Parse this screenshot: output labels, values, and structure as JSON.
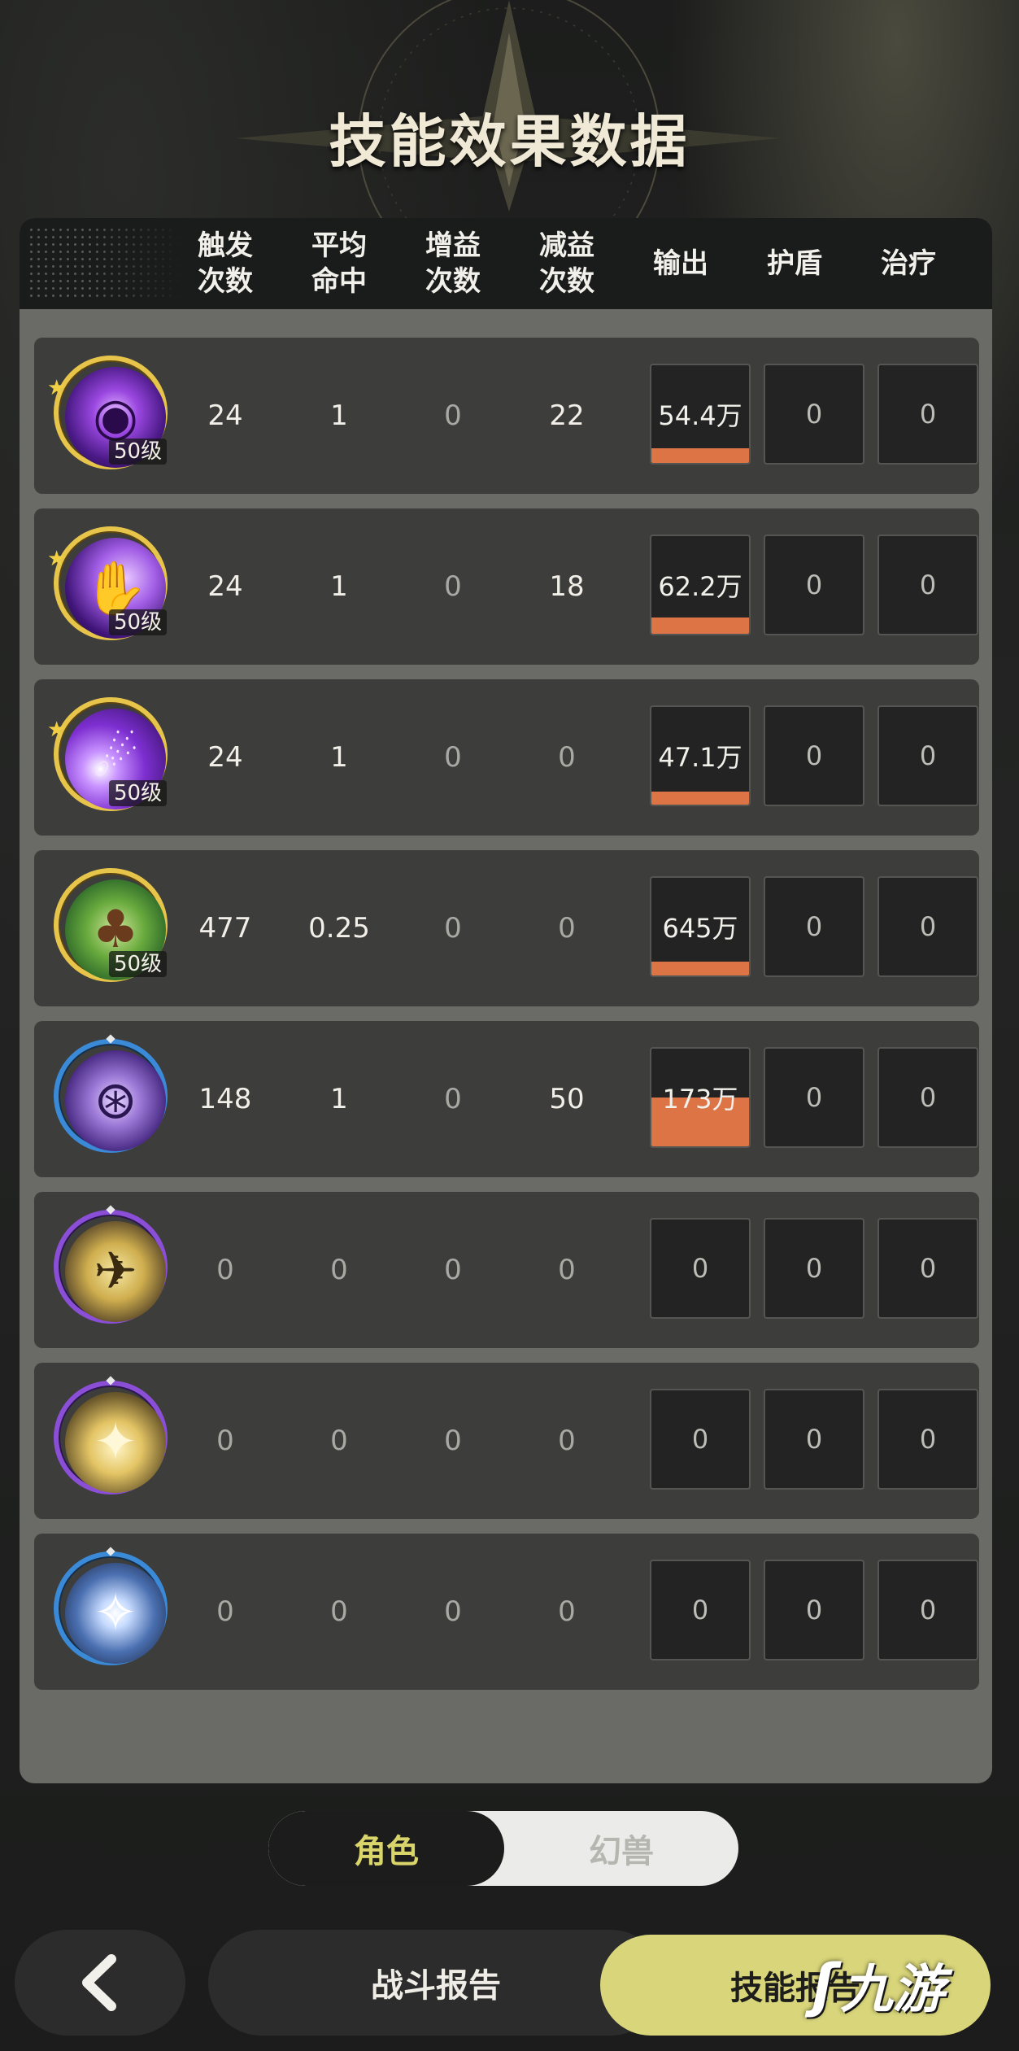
{
  "page": {
    "title": "技能效果数据"
  },
  "columns": [
    "触发\n次数",
    "平均\n命中",
    "增益\n次数",
    "减益\n次数",
    "输出",
    "护盾",
    "治疗"
  ],
  "rows": [
    {
      "icon": "purple-eye-skill-icon",
      "ring": "gold",
      "star": true,
      "level": "50级",
      "trigger": "24",
      "avg_hit": "1",
      "buff": "0",
      "debuff": "22",
      "output": "54.4万",
      "output_fill": 0.15,
      "shield": "0",
      "heal": "0"
    },
    {
      "icon": "purple-hand-skill-icon",
      "ring": "gold",
      "star": true,
      "level": "50级",
      "trigger": "24",
      "avg_hit": "1",
      "buff": "0",
      "debuff": "18",
      "output": "62.2万",
      "output_fill": 0.17,
      "shield": "0",
      "heal": "0"
    },
    {
      "icon": "purple-vortex-skill-icon",
      "ring": "gold",
      "star": true,
      "level": "50级",
      "trigger": "24",
      "avg_hit": "1",
      "buff": "0",
      "debuff": "0",
      "output": "47.1万",
      "output_fill": 0.13,
      "shield": "0",
      "heal": "0"
    },
    {
      "icon": "green-tree-skill-icon",
      "ring": "gold",
      "star": false,
      "level": "50级",
      "trigger": "477",
      "avg_hit": "0.25",
      "buff": "0",
      "debuff": "0",
      "output": "645万",
      "output_fill": 0.14,
      "shield": "0",
      "heal": "0"
    },
    {
      "icon": "purple-totem-skill-icon",
      "ring": "blue",
      "star": false,
      "level": "",
      "trigger": "148",
      "avg_hit": "1",
      "buff": "0",
      "debuff": "50",
      "output": "173万",
      "output_fill": 0.5,
      "shield": "0",
      "heal": "0"
    },
    {
      "icon": "gold-beast-skill-icon",
      "ring": "purple",
      "star": false,
      "level": "",
      "trigger": "0",
      "avg_hit": "0",
      "buff": "0",
      "debuff": "0",
      "output": "0",
      "output_fill": 0,
      "shield": "0",
      "heal": "0"
    },
    {
      "icon": "gold-burst-skill-icon",
      "ring": "purple",
      "star": false,
      "level": "",
      "trigger": "0",
      "avg_hit": "0",
      "buff": "0",
      "debuff": "0",
      "output": "0",
      "output_fill": 0,
      "shield": "0",
      "heal": "0"
    },
    {
      "icon": "blue-star-skill-icon",
      "ring": "blue",
      "star": false,
      "level": "",
      "trigger": "0",
      "avg_hit": "0",
      "buff": "0",
      "debuff": "0",
      "output": "0",
      "output_fill": 0,
      "shield": "0",
      "heal": "0"
    }
  ],
  "toggle": {
    "active": "角色",
    "inactive": "幻兽"
  },
  "footer": {
    "back_icon": "chevron-left-icon",
    "battle_report": "战斗报告",
    "skill_report": "技能报告",
    "watermark": "九游"
  },
  "colors": {
    "accent": "#dc7445",
    "button": "#d8d57a",
    "toggle_active_text": "#d9d56a"
  }
}
